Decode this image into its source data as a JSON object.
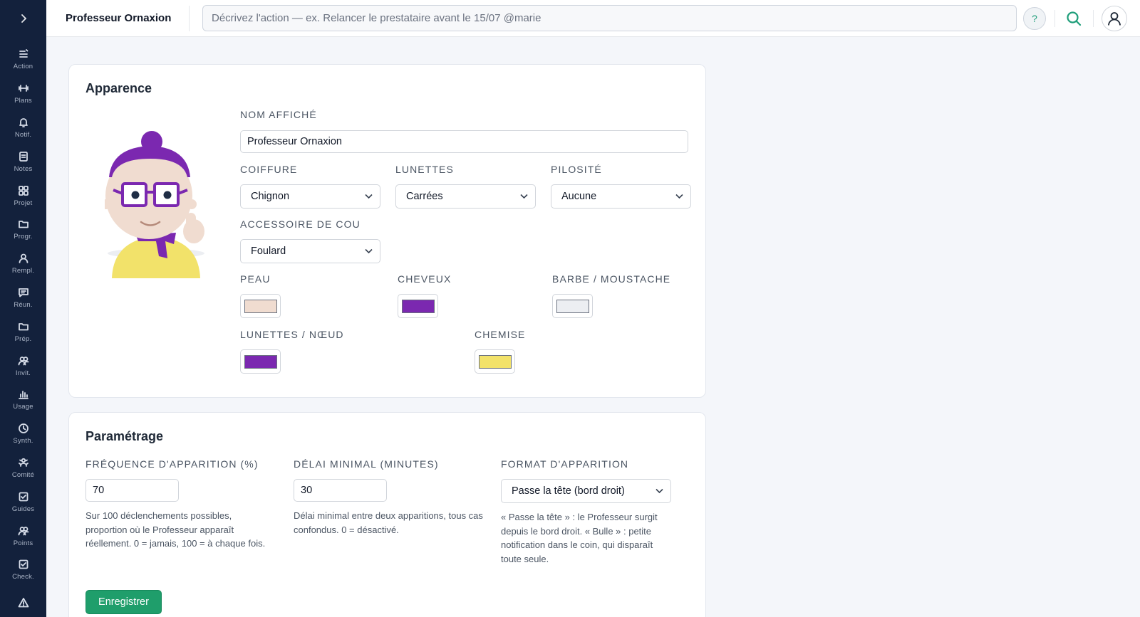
{
  "sidebar": {
    "toggle_icon": "chevron-right-icon",
    "items": [
      {
        "label": "Action",
        "icon": "action-list-icon"
      },
      {
        "label": "Plans",
        "icon": "plans-icon"
      },
      {
        "label": "Notif.",
        "icon": "bell-icon"
      },
      {
        "label": "Notes",
        "icon": "note-icon"
      },
      {
        "label": "Projet",
        "icon": "grid-icon"
      },
      {
        "label": "Progr.",
        "icon": "folder-icon"
      },
      {
        "label": "Rempl.",
        "icon": "user-icon"
      },
      {
        "label": "Réun.",
        "icon": "message-icon"
      },
      {
        "label": "Prép.",
        "icon": "folder-icon"
      },
      {
        "label": "Invit.",
        "icon": "users-icon"
      },
      {
        "label": "Usage",
        "icon": "bar-chart-icon"
      },
      {
        "label": "Synth.",
        "icon": "clock-icon"
      },
      {
        "label": "Comité",
        "icon": "committee-icon"
      },
      {
        "label": "Guides",
        "icon": "check-square-icon"
      },
      {
        "label": "Points",
        "icon": "users-icon"
      },
      {
        "label": "Check.",
        "icon": "check-square-icon"
      },
      {
        "label": "",
        "icon": "warning-icon"
      }
    ]
  },
  "header": {
    "title": "Professeur Ornaxion",
    "command_placeholder": "Décrivez l'action — ex. Relancer le prestataire avant le 15/07 @marie",
    "help_label": "?",
    "accent": "#1f9e7a"
  },
  "appearance": {
    "title": "Apparence",
    "display_name": {
      "label": "Nom affiché",
      "value": "Professeur Ornaxion"
    },
    "hairstyle": {
      "label": "Coiffure",
      "value": "Chignon"
    },
    "glasses": {
      "label": "Lunettes",
      "value": "Carrées"
    },
    "facial_hair": {
      "label": "Pilosité",
      "value": "Aucune"
    },
    "neck_accessory": {
      "label": "Accessoire de cou",
      "value": "Foulard"
    },
    "colors": {
      "skin": {
        "label": "Peau",
        "color": "#f0dcd0"
      },
      "hair": {
        "label": "Cheveux",
        "color": "#7b28b0"
      },
      "beard": {
        "label": "Barbe / moustache",
        "color": "#eceef2"
      },
      "glasses_bow": {
        "label": "Lunettes / nœud",
        "color": "#7b28b0"
      },
      "shirt": {
        "label": "Chemise",
        "color": "#f2e26a"
      }
    }
  },
  "settings": {
    "title": "Paramétrage",
    "frequency": {
      "label": "Fréquence d'apparition (%)",
      "value": "70",
      "help": "Sur 100 déclenchements possibles, proportion où le Professeur apparaît réellement. 0 = jamais, 100 = à chaque fois."
    },
    "min_delay": {
      "label": "Délai minimal (minutes)",
      "value": "30",
      "help": "Délai minimal entre deux apparitions, tous cas confondus. 0 = désactivé."
    },
    "format": {
      "label": "Format d'apparition",
      "value": "Passe la tête (bord droit)",
      "help": "« Passe la tête » : le Professeur surgit depuis le bord droit. « Bulle » : petite notification dans le coin, qui disparaît toute seule."
    },
    "save_label": "Enregistrer",
    "save_color": "#1f9e6b"
  }
}
